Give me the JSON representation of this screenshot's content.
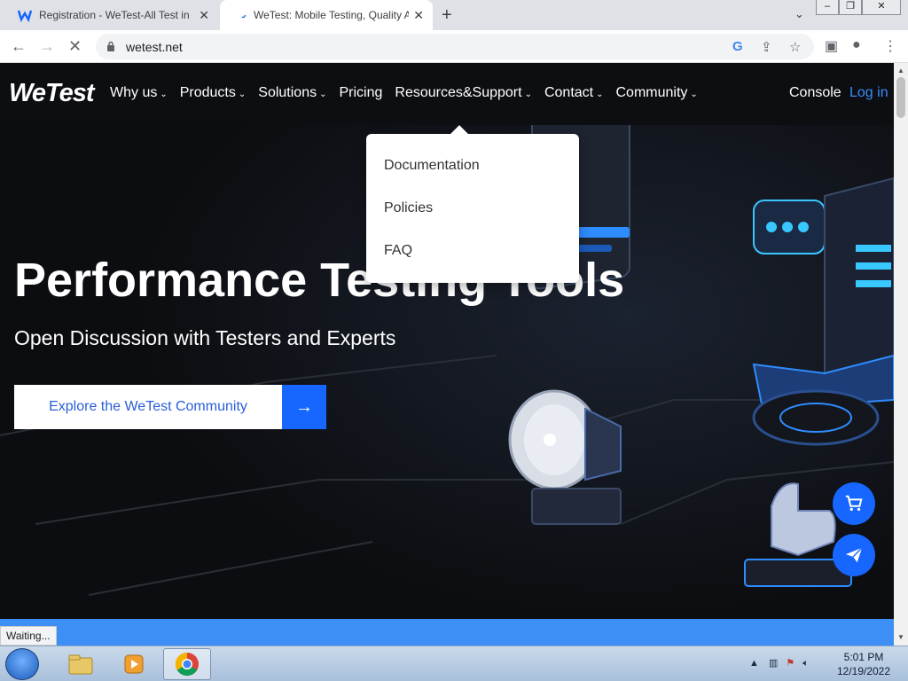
{
  "browser": {
    "tabs": [
      {
        "title": "Registration - WeTest-All Test in ",
        "active": false
      },
      {
        "title": "WeTest: Mobile Testing, Quality A",
        "active": true
      }
    ],
    "new_tab_symbol": "+",
    "url": "wetest.net",
    "status_text": "Waiting...",
    "icons": {
      "back": "arrow-left-icon",
      "forward": "arrow-right-icon",
      "reload": "loading-spinner-icon",
      "lock": "lock-icon",
      "google": "google-g-icon",
      "share": "share-icon",
      "bookmark": "star-icon",
      "sidepanel": "side-panel-icon",
      "profile": "profile-icon",
      "menu": "kebab-menu-icon"
    }
  },
  "site": {
    "logo": "WeTest",
    "nav": [
      {
        "label": "Why us",
        "has_dropdown": true
      },
      {
        "label": "Products",
        "has_dropdown": true
      },
      {
        "label": "Solutions",
        "has_dropdown": true
      },
      {
        "label": "Pricing",
        "has_dropdown": false
      },
      {
        "label": "Resources&Support",
        "has_dropdown": true
      },
      {
        "label": "Contact",
        "has_dropdown": true
      },
      {
        "label": "Community",
        "has_dropdown": true
      }
    ],
    "console": "Console",
    "login": "Log in",
    "dropdown_items": [
      "Documentation",
      "Policies",
      "FAQ"
    ],
    "hero": {
      "title": "Performance Testing Tools",
      "subtitle": "Open Discussion with Testers and Experts",
      "cta_label": "Explore the WeTest Community",
      "cta_arrow": "→"
    },
    "floating_buttons": [
      "cart-icon",
      "paper-plane-icon"
    ],
    "colors": {
      "accent": "#1766ff",
      "login": "#3d8bff",
      "nav_bg": "#0d0e11",
      "strip": "#3d8ff5"
    }
  },
  "taskbar": {
    "apps": [
      "windows-explorer-icon",
      "media-player-icon",
      "chrome-icon"
    ],
    "time": "5:01 PM",
    "date": "12/19/2022"
  }
}
